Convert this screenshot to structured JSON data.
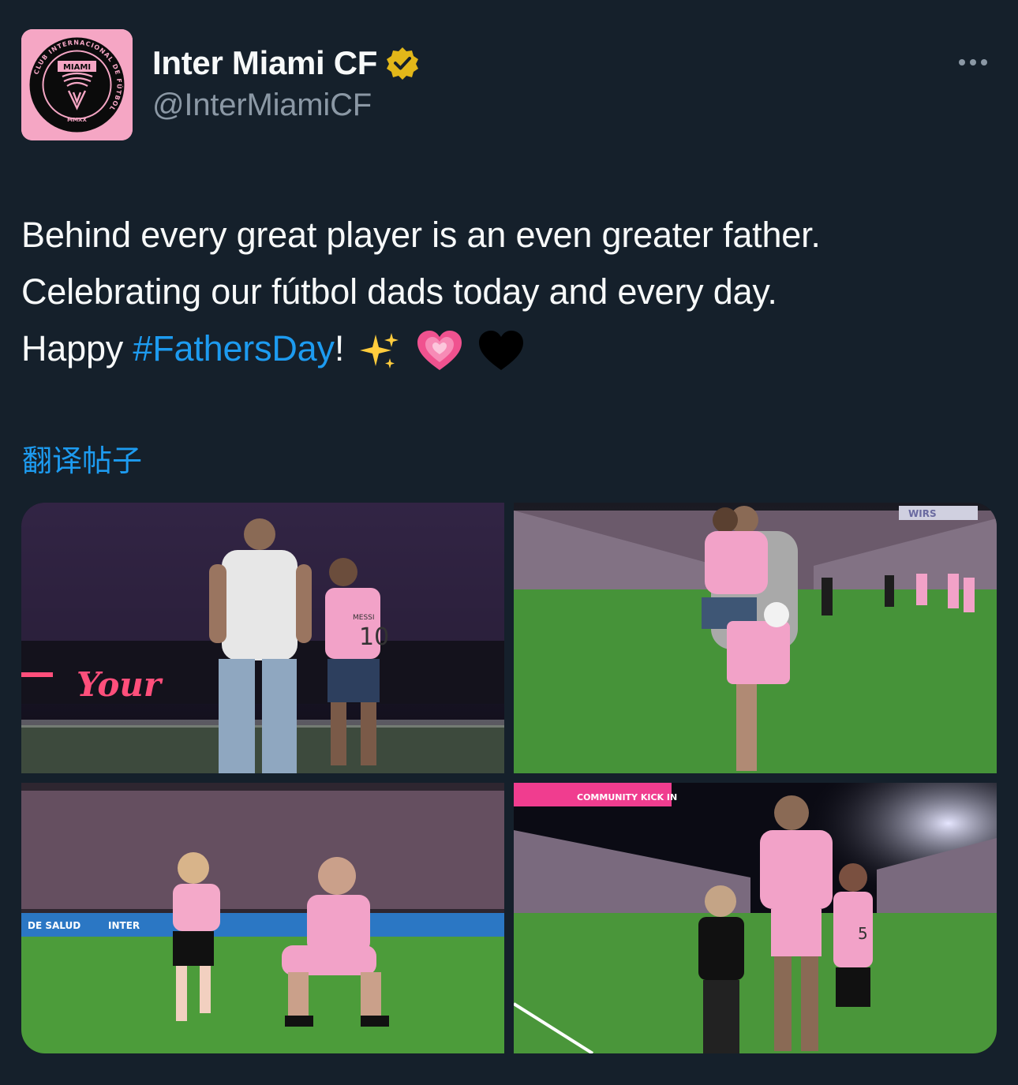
{
  "account": {
    "display_name": "Inter Miami CF",
    "handle": "@InterMiamiCF",
    "verified_icon": "verified-gold-badge-icon",
    "avatar": {
      "logo_ring_text": "CLUB INTERNACIONAL DE FÚTBOL",
      "logo_top_text": "MIAMI",
      "logo_bottom_text": "MMXX"
    }
  },
  "more_icon": "more-horizontal-icon",
  "tweet": {
    "line1": "Behind every great player is an even greater father.",
    "line2": "Celebrating our fútbol dads today and every day.",
    "line3_prefix": "Happy ",
    "hashtag": "#FathersDay",
    "line3_suffix": "!",
    "emojis": [
      "sparkles",
      "growing-heart",
      "black-heart"
    ]
  },
  "translate_label": "翻译帖子",
  "media": {
    "photos": [
      {
        "id": "photo-1",
        "texts": [
          "Your",
          "MESSI",
          "10"
        ]
      },
      {
        "id": "photo-2",
        "texts": [
          "WIRS"
        ]
      },
      {
        "id": "photo-3",
        "texts": [
          "DE SALUD",
          "INTER"
        ]
      },
      {
        "id": "photo-4",
        "texts": [
          "COMMUNITY KICK IN",
          "5"
        ]
      }
    ]
  },
  "colors": {
    "background": "#15202b",
    "text_primary": "#f7f9f9",
    "text_secondary": "#8b98a5",
    "link": "#1d9bf0",
    "brand_pink": "#f5a6c4"
  }
}
